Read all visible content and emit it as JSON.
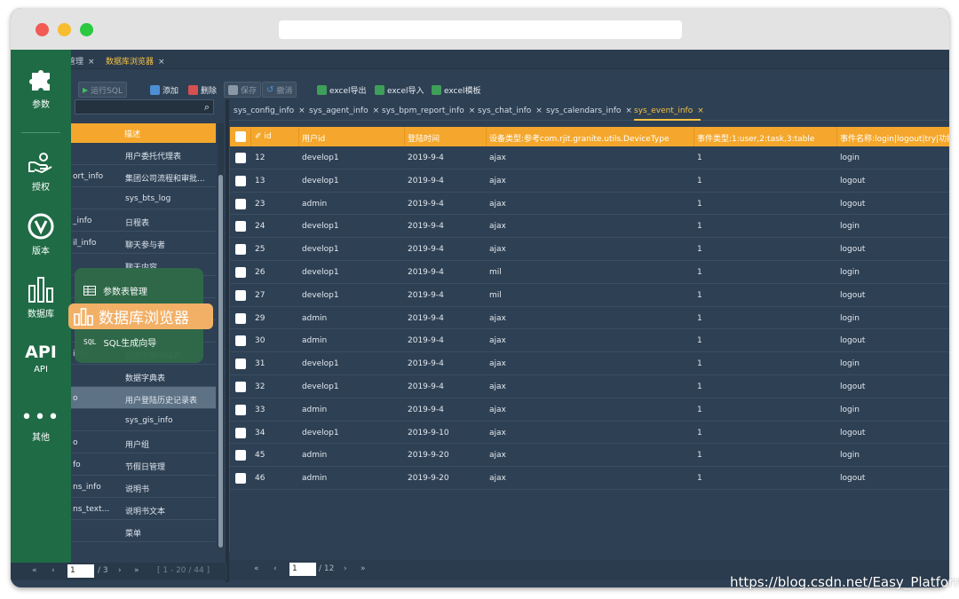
{
  "top_tabs": [
    {
      "label": "管理",
      "close": "×"
    },
    {
      "label": "数据库浏览器",
      "close": "×"
    }
  ],
  "toolbar": {
    "run_sql": "运行SQL",
    "add": "添加",
    "delete": "删除",
    "save": "保存",
    "undo": "撤消",
    "excel_export": "excel导出",
    "excel_import": "excel导入",
    "excel_template": "excel模板"
  },
  "sidebar": {
    "items": [
      {
        "label": "参数",
        "icon": "puzzle-icon"
      },
      {
        "label": "授权",
        "icon": "hand-icon"
      },
      {
        "label": "版本",
        "icon": "version-icon"
      },
      {
        "label": "数据库",
        "icon": "database-icon"
      },
      {
        "label": "API",
        "icon": "api-icon"
      },
      {
        "label": "其他",
        "icon": "more-icon"
      }
    ]
  },
  "popup_menu": {
    "items": [
      {
        "label": "参数表管理",
        "icon": "table-icon"
      },
      {
        "label": "数据库浏览器",
        "icon": "database-icon"
      },
      {
        "label": "SQL生成向导",
        "icon": "sql-icon"
      }
    ]
  },
  "left_list": {
    "header": "描述",
    "rows": [
      {
        "name": "",
        "desc": "用户委托代理表"
      },
      {
        "name": "ort_info",
        "desc": "集团公司流程和审批..."
      },
      {
        "name": "",
        "desc": "sys_bts_log"
      },
      {
        "name": "_info",
        "desc": "日程表"
      },
      {
        "name": "il_info",
        "desc": "聊天参与者"
      },
      {
        "name": "",
        "desc": "聊天内容"
      },
      {
        "name": "",
        "desc": ""
      },
      {
        "name": "",
        "desc": ""
      },
      {
        "name": "",
        "desc": ""
      },
      {
        "name": "info",
        "desc": "数据字典明细表"
      },
      {
        "name": "",
        "desc": "数据字典表"
      },
      {
        "name": "o",
        "desc": "用户登陆历史记录表"
      },
      {
        "name": "",
        "desc": "sys_gis_info"
      },
      {
        "name": "o",
        "desc": "用户组"
      },
      {
        "name": "fo",
        "desc": "节假日管理"
      },
      {
        "name": "ns_info",
        "desc": "说明书"
      },
      {
        "name": "ns_text...",
        "desc": "说明书文本"
      },
      {
        "name": "",
        "desc": "菜单"
      }
    ],
    "selected_index": 11,
    "pager": {
      "first": "«",
      "prev": "‹",
      "page": "1",
      "total": "/ 3",
      "next": "›",
      "last": "»",
      "range": "[ 1 - 20 / 44 ]"
    }
  },
  "right_tabs": [
    {
      "label": "sys_config_info",
      "close": "×"
    },
    {
      "label": "sys_agent_info",
      "close": "×"
    },
    {
      "label": "sys_bpm_report_info",
      "close": "×"
    },
    {
      "label": "sys_chat_info",
      "close": "×"
    },
    {
      "label": "sys_calendars_info",
      "close": "×"
    },
    {
      "label": "sys_event_info",
      "close": "×"
    }
  ],
  "grid": {
    "columns": [
      "id",
      "用户id",
      "登陆时间",
      "设备类型:参考com.rjit.granite.utils.DeviceType",
      "事件类型:1:user,2:task,3:table",
      "事件名称:login|logout|try|功能名"
    ],
    "key_icon": "✐",
    "rows": [
      [
        "12",
        "develop1",
        "2019-9-4",
        "ajax",
        "1",
        "login"
      ],
      [
        "13",
        "develop1",
        "2019-9-4",
        "ajax",
        "1",
        "logout"
      ],
      [
        "23",
        "admin",
        "2019-9-4",
        "ajax",
        "1",
        "logout"
      ],
      [
        "24",
        "develop1",
        "2019-9-4",
        "ajax",
        "1",
        "login"
      ],
      [
        "25",
        "develop1",
        "2019-9-4",
        "ajax",
        "1",
        "logout"
      ],
      [
        "26",
        "develop1",
        "2019-9-4",
        "mil",
        "1",
        "login"
      ],
      [
        "27",
        "develop1",
        "2019-9-4",
        "mil",
        "1",
        "logout"
      ],
      [
        "29",
        "admin",
        "2019-9-4",
        "ajax",
        "1",
        "login"
      ],
      [
        "30",
        "admin",
        "2019-9-4",
        "ajax",
        "1",
        "logout"
      ],
      [
        "31",
        "develop1",
        "2019-9-4",
        "ajax",
        "1",
        "login"
      ],
      [
        "32",
        "develop1",
        "2019-9-4",
        "ajax",
        "1",
        "logout"
      ],
      [
        "33",
        "admin",
        "2019-9-4",
        "ajax",
        "1",
        "login"
      ],
      [
        "34",
        "develop1",
        "2019-9-10",
        "ajax",
        "1",
        "logout"
      ],
      [
        "45",
        "admin",
        "2019-9-20",
        "ajax",
        "1",
        "login"
      ],
      [
        "46",
        "admin",
        "2019-9-20",
        "ajax",
        "1",
        "logout"
      ]
    ],
    "pager": {
      "first": "«",
      "prev": "‹",
      "page": "1",
      "total": "/ 12",
      "next": "›",
      "last": "»"
    }
  },
  "watermark": "https://blog.csdn.net/Easy_Platform",
  "colors": {
    "accent": "#f4a72c",
    "sidebar": "#1f6b45",
    "background": "#2e4054",
    "active_tab": "#f6c244"
  }
}
